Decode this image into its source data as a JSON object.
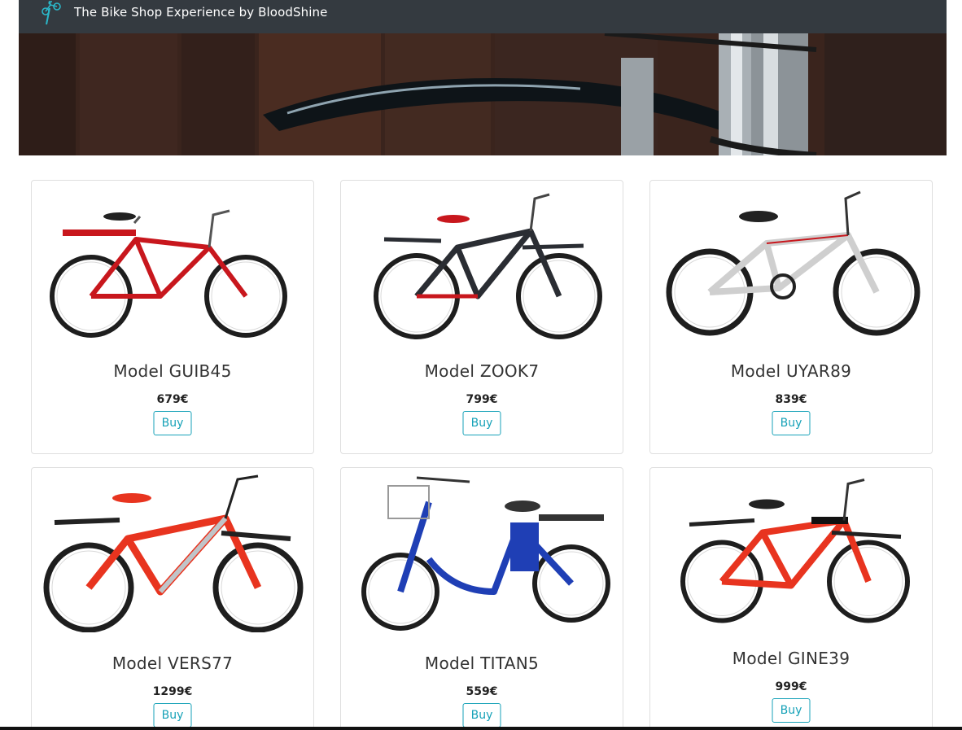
{
  "navbar": {
    "brand": "The Bike Shop Experience by BloodShine",
    "logo_icon": "cyclist-logo-icon"
  },
  "products": [
    {
      "name": "Model GUIB45",
      "price": "679€",
      "buy_label": "Buy",
      "frame_color": "#c8171d",
      "accent": "#c8171d"
    },
    {
      "name": "Model ZOOK7",
      "price": "799€",
      "buy_label": "Buy",
      "frame_color": "#2a2d33",
      "accent": "#c8171d"
    },
    {
      "name": "Model UYAR89",
      "price": "839€",
      "buy_label": "Buy",
      "frame_color": "#f4f4f4",
      "accent": "#c8171d"
    },
    {
      "name": "Model VERS77",
      "price": "1299€",
      "buy_label": "Buy",
      "frame_color": "#e8341f",
      "accent": "#c0c4c8"
    },
    {
      "name": "Model TITAN5",
      "price": "559€",
      "buy_label": "Buy",
      "frame_color": "#1f3fb5",
      "accent": "#1f3fb5"
    },
    {
      "name": "Model GINE39",
      "price": "999€",
      "buy_label": "Buy",
      "frame_color": "#e8341f",
      "accent": "#111111"
    }
  ],
  "colors": {
    "navbar": "#343a40",
    "button_outline": "#17a2b8"
  }
}
